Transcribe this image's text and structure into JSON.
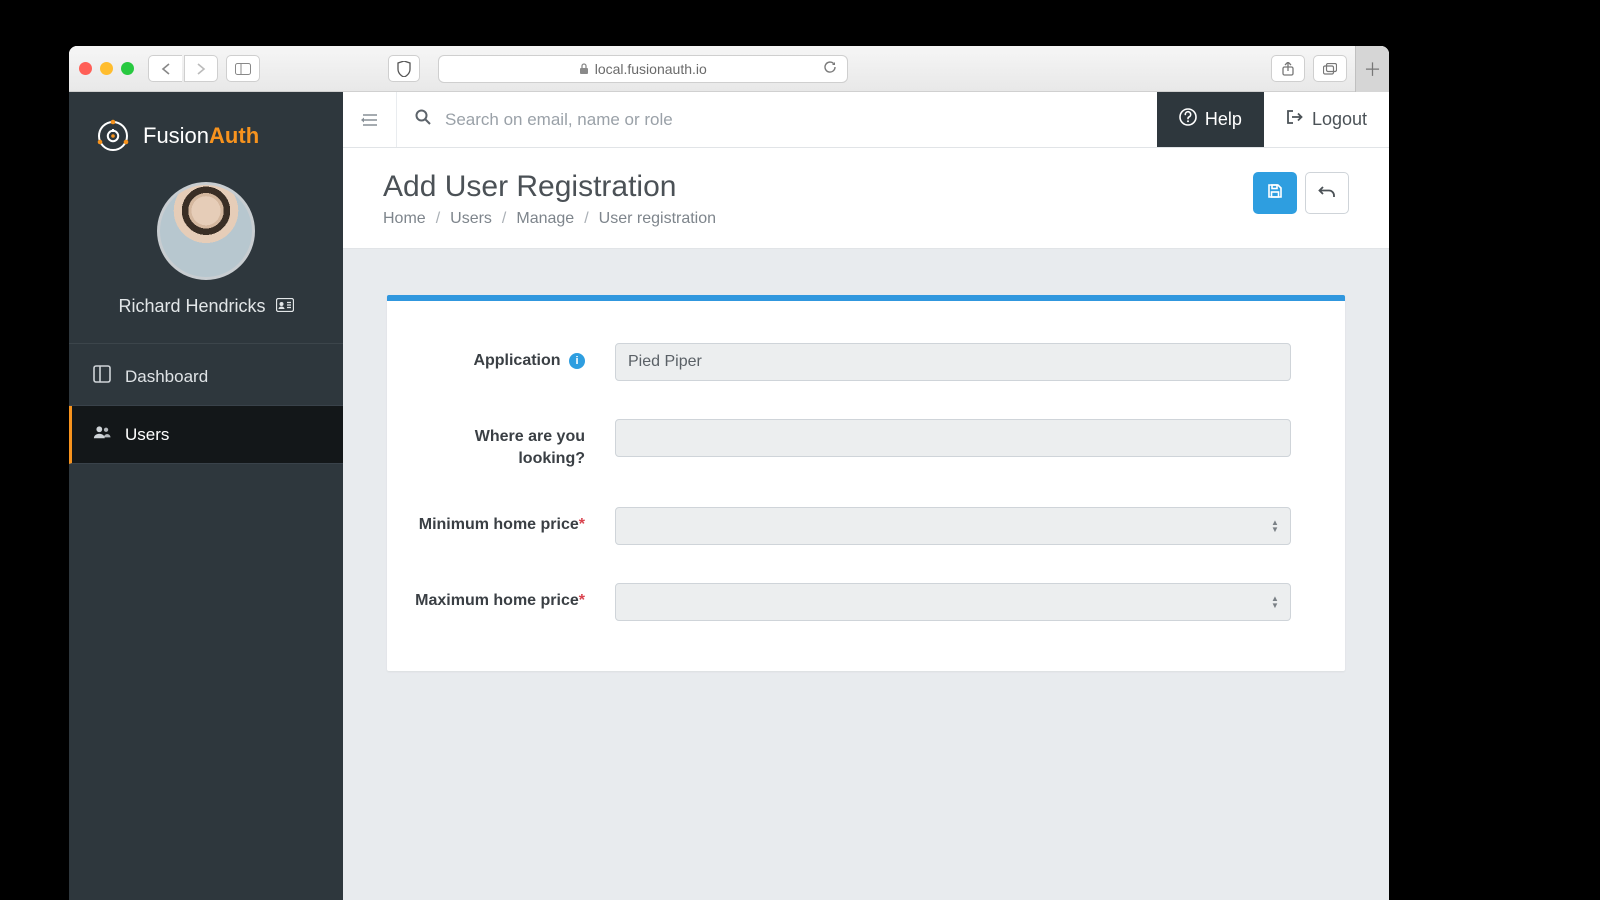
{
  "browser": {
    "url": "local.fusionauth.io"
  },
  "brand": {
    "name_main": "Fusion",
    "name_accent": "Auth"
  },
  "user": {
    "display_name": "Richard Hendricks"
  },
  "sidebar": {
    "items": [
      {
        "label": "Dashboard"
      },
      {
        "label": "Users"
      }
    ],
    "active_index": 1
  },
  "topbar": {
    "search_placeholder": "Search on email, name or role",
    "help_label": "Help",
    "logout_label": "Logout"
  },
  "header": {
    "title": "Add User Registration",
    "breadcrumb": [
      "Home",
      "Users",
      "Manage",
      "User registration"
    ]
  },
  "form": {
    "fields": [
      {
        "label": "Application",
        "info": true,
        "required": false,
        "type": "text",
        "value": "Pied Piper"
      },
      {
        "label": "Where are you looking?",
        "info": false,
        "required": false,
        "type": "text",
        "value": ""
      },
      {
        "label": "Minimum home price",
        "info": false,
        "required": true,
        "type": "number",
        "value": ""
      },
      {
        "label": "Maximum home price",
        "info": false,
        "required": true,
        "type": "number",
        "value": ""
      }
    ]
  },
  "colors": {
    "accent": "#f7931e",
    "primary": "#2e9ee0"
  }
}
